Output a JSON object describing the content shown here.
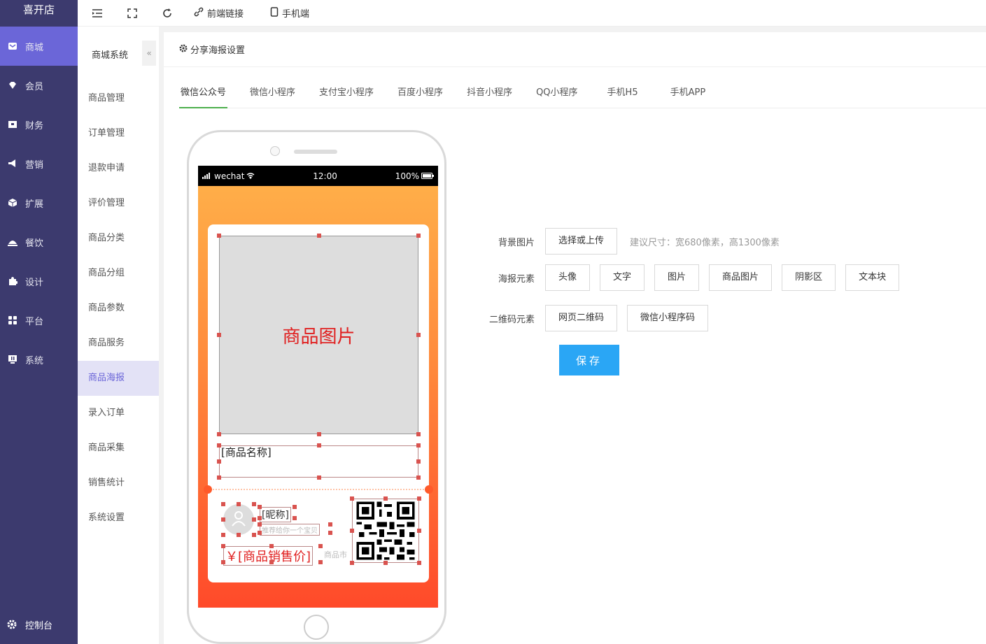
{
  "brand": "喜开店",
  "sidebar": {
    "items": [
      {
        "label": "商城",
        "icon": "store-icon"
      },
      {
        "label": "会员",
        "icon": "member-icon"
      },
      {
        "label": "财务",
        "icon": "finance-icon"
      },
      {
        "label": "营销",
        "icon": "megaphone-icon"
      },
      {
        "label": "扩展",
        "icon": "cube-icon"
      },
      {
        "label": "餐饮",
        "icon": "dining-icon"
      },
      {
        "label": "设计",
        "icon": "puzzle-icon"
      },
      {
        "label": "平台",
        "icon": "grid-icon"
      },
      {
        "label": "系统",
        "icon": "monitor-icon"
      }
    ],
    "dashboard": "控制台"
  },
  "topbar": {
    "link_frontend": "前端链接",
    "link_mobile": "手机端"
  },
  "subnav": {
    "title": "商城系统",
    "collapse": "«",
    "items": [
      "商品管理",
      "订单管理",
      "退款申请",
      "评价管理",
      "商品分类",
      "商品分组",
      "商品参数",
      "商品服务",
      "商品海报",
      "录入订单",
      "商品采集",
      "销售统计",
      "系统设置"
    ]
  },
  "page": {
    "title": "分享海报设置",
    "tabs": [
      "微信公众号",
      "微信小程序",
      "支付宝小程序",
      "百度小程序",
      "抖音小程序",
      "QQ小程序",
      "手机H5",
      "手机APP"
    ]
  },
  "phone": {
    "status_carrier": "wechat",
    "status_time": "12:00",
    "status_battery": "100%",
    "goods_image": "商品图片",
    "goods_name": "[商品名称]",
    "nickname": "[昵称]",
    "recommend": "推荐给你一个宝贝",
    "price": "￥[商品销售价]",
    "market_price": "商品市"
  },
  "form": {
    "bg_label": "背景图片",
    "bg_button": "选择或上传",
    "bg_hint": "建议尺寸：宽680像素，高1300像素",
    "elements_label": "海报元素",
    "elements": [
      "头像",
      "文字",
      "图片",
      "商品图片",
      "阴影区",
      "文本块"
    ],
    "qr_label": "二维码元素",
    "qr_buttons": [
      "网页二维码",
      "微信小程序码"
    ],
    "save": "保存"
  }
}
